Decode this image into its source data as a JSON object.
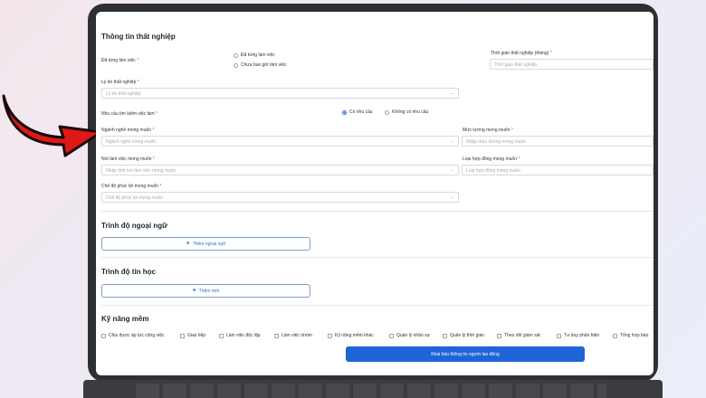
{
  "unemployment": {
    "title": "Thông tin thất nghiệp",
    "worked_label": "Đã từng làm việc",
    "worked_options": [
      "Đã từng làm việc",
      "Chưa bao giờ làm việc"
    ],
    "duration_label": "Thời gian thất nghiệp (tháng)",
    "duration_placeholder": "Thời gian thất nghiệp",
    "reason_label": "Lý do thất nghiệp",
    "reason_placeholder": "Lý do thất nghiệp",
    "job_need_label": "Nhu cầu tìm kiếm việc làm",
    "job_need_options": [
      "Có nhu cầu",
      "Không có nhu cầu"
    ],
    "job_need_selected": "Có nhu cầu",
    "desired_job_label": "Ngành nghề mong muốn",
    "desired_job_placeholder": "Ngành nghề mong muốn",
    "desired_salary_label": "Mức lương mong muốn",
    "desired_salary_placeholder": "Nhập mức lương mong muốn",
    "workplace_label": "Nơi làm việc mong muốn",
    "workplace_placeholder": "Nhập tỉnh nơi làm việc mong muốn",
    "contract_label": "Loại hợp đồng mong muốn",
    "contract_placeholder": "Loại hợp đồng mong muốn",
    "benefits_label": "Chế độ phúc lợi mong muốn",
    "benefits_placeholder": "Chế độ phúc lợi mong muốn"
  },
  "language": {
    "title": "Trình độ ngoại ngữ",
    "add_label": "Thêm ngoại ngữ"
  },
  "it": {
    "title": "Trình độ tin học",
    "add_label": "Thêm mới"
  },
  "soft_skills": {
    "title": "Kỹ năng mềm",
    "items": [
      "Chịu được áp lực công việc",
      "Giao tiếp",
      "Làm việc độc lập",
      "Làm việc nhóm",
      "Kỹ năng mềm khác",
      "Quản lý nhân sự",
      "Quản lý thời gian",
      "Theo dõi giám sát",
      "Tư duy phản biện",
      "Tổng hợp báo"
    ]
  },
  "submit_label": "Khai báo thông tin người lao động",
  "required_mark": "*",
  "colors": {
    "accent": "#1f64d6",
    "required": "#e23b3b",
    "arrow": "#e01818"
  }
}
